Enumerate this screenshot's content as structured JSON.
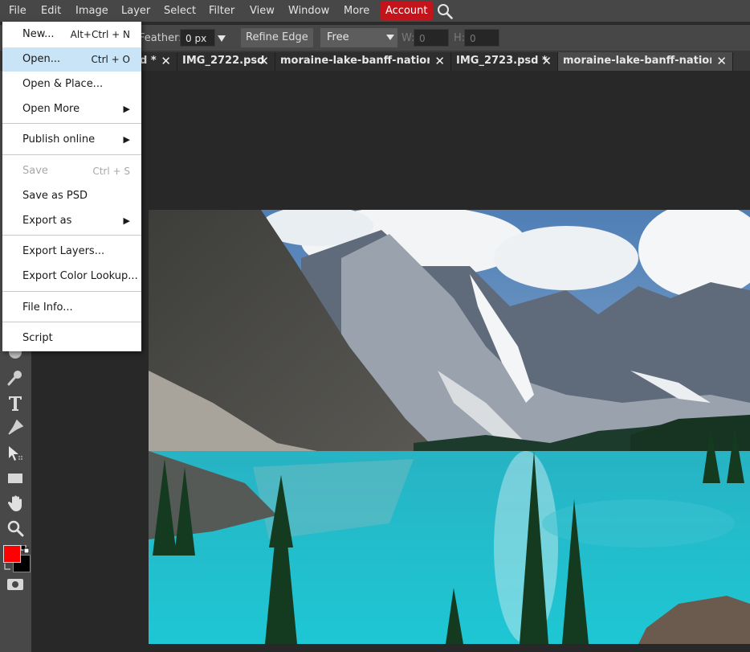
{
  "menubar": {
    "items": [
      "File",
      "Edit",
      "Image",
      "Layer",
      "Select",
      "Filter",
      "View",
      "Window",
      "More"
    ],
    "account": "Account",
    "search_icon": "search-icon"
  },
  "options": {
    "feather_label": "Feather:",
    "feather_value": "0",
    "feather_unit": "px",
    "refine_edge": "Refine Edge",
    "mode": "Free",
    "w_label": "W:",
    "w_value": "0",
    "h_label": "H:",
    "h_value": "0"
  },
  "tabs": [
    {
      "label": "d *"
    },
    {
      "label": "IMG_2722.psd"
    },
    {
      "label": "moraine-lake-banff-national"
    },
    {
      "label": "IMG_2723.psd *"
    },
    {
      "label": "moraine-lake-banff-national"
    }
  ],
  "file_menu": {
    "items": [
      {
        "label": "New...",
        "shortcut": "Alt+Ctrl + N"
      },
      {
        "label": "Open...",
        "shortcut": "Ctrl + O"
      },
      {
        "label": "Open & Place..."
      },
      {
        "label": "Open More"
      },
      {
        "label": "Publish online"
      },
      {
        "label": "Save",
        "shortcut": "Ctrl + S"
      },
      {
        "label": "Save as PSD"
      },
      {
        "label": "Export as"
      },
      {
        "label": "Export Layers..."
      },
      {
        "label": "Export Color Lookup..."
      },
      {
        "label": "File Info..."
      },
      {
        "label": "Script"
      }
    ]
  },
  "colors": {
    "accent": "#c4141b",
    "foreground": "#ff0000",
    "background": "#000000",
    "menu_highlight": "#c9e3f7"
  },
  "tools": [
    "brush-icon",
    "smudge-icon",
    "text-icon",
    "pen-icon",
    "path-select-icon",
    "rectangle-icon",
    "hand-icon",
    "zoom-icon",
    "color-swatches",
    "quick-mask-icon"
  ]
}
